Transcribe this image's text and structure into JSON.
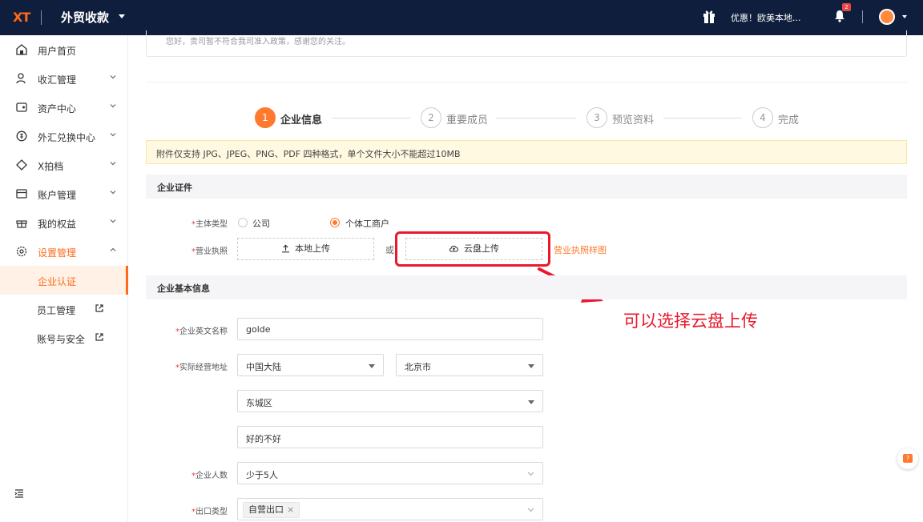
{
  "topbar": {
    "logo_text": "XT",
    "app_title": "外贸收款",
    "promo_text": "优惠！欧美本地...",
    "notification_count": "2"
  },
  "sidebar": {
    "items": [
      {
        "label": "用户首页",
        "icon": "home-icon"
      },
      {
        "label": "收汇管理",
        "icon": "person-icon"
      },
      {
        "label": "资产中心",
        "icon": "wallet-icon"
      },
      {
        "label": "外汇兑换中心",
        "icon": "exchange-icon"
      },
      {
        "label": "X拍档",
        "icon": "diamond-icon"
      },
      {
        "label": "账户管理",
        "icon": "card-icon"
      },
      {
        "label": "我的权益",
        "icon": "gift-icon"
      },
      {
        "label": "设置管理",
        "icon": "gear-icon"
      }
    ],
    "sub_items": [
      {
        "label": "企业认证"
      },
      {
        "label": "员工管理"
      },
      {
        "label": "账号与安全"
      }
    ]
  },
  "notice": {
    "text": "您好，贵司暂不符合我司准入政策，感谢您的关注。"
  },
  "steps": [
    {
      "number": "1",
      "label": "企业信息"
    },
    {
      "number": "2",
      "label": "重要成员"
    },
    {
      "number": "3",
      "label": "预览资料"
    },
    {
      "number": "4",
      "label": "完成"
    }
  ],
  "tip": {
    "text": "附件仅支持 JPG、JPEG、PNG、PDF 四种格式，单个文件大小不能超过10MB"
  },
  "cert_section": {
    "title": "企业证件",
    "entity_type_label": "主体类型",
    "options": [
      "公司",
      "个体工商户"
    ],
    "license_label": "营业执照",
    "local_upload": "本地上传",
    "or_text": "或",
    "cloud_upload": "云盘上传",
    "sample_link": "营业执照样图"
  },
  "basic_section": {
    "title": "企业基本信息",
    "english_name_label": "企业英文名称",
    "english_name_value": "golde",
    "address_label": "实际经营地址",
    "region_value": "中国大陆",
    "city_value": "北京市",
    "district_value": "东城区",
    "street_value": "好的不好",
    "staff_label": "企业人数",
    "staff_value": "少于5人",
    "export_label": "出口类型",
    "export_tag": "自营出口",
    "tag_close": "×"
  },
  "annotation": {
    "text": "可以选择云盘上传"
  },
  "help": {
    "text": "?"
  },
  "colors": {
    "accent": "#ff7a2f",
    "topbar": "#0f1e3c",
    "annotation": "#e8192c"
  }
}
